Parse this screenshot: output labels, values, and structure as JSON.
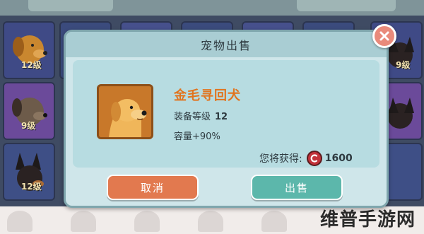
{
  "dialog": {
    "title": "宠物出售",
    "pet": {
      "name": "金毛寻回犬",
      "equip_level_label": "装备等级",
      "equip_level_value": "12",
      "capacity_label": "容量",
      "capacity_value": "+90%"
    },
    "earn_label": "您将获得:",
    "earn_amount": "1600",
    "cancel_label": "取消",
    "sell_label": "出售"
  },
  "background": {
    "slots": [
      {
        "level": "12级"
      },
      {
        "level": "9级"
      },
      {
        "level": "12级"
      }
    ],
    "right_slots": [
      {
        "level": "9级"
      },
      {
        "level": ""
      }
    ]
  },
  "watermark": "维普手游网",
  "colors": {
    "dialog_bg": "#cfe6ea",
    "title_orange": "#e1741e",
    "cancel_button": "#e2794f",
    "sell_button": "#5cb7ab",
    "coin_red": "#c2323a",
    "close_button": "#e98a7b"
  },
  "icons": [
    "close-icon",
    "coin-icon",
    "golden-retriever-portrait"
  ]
}
